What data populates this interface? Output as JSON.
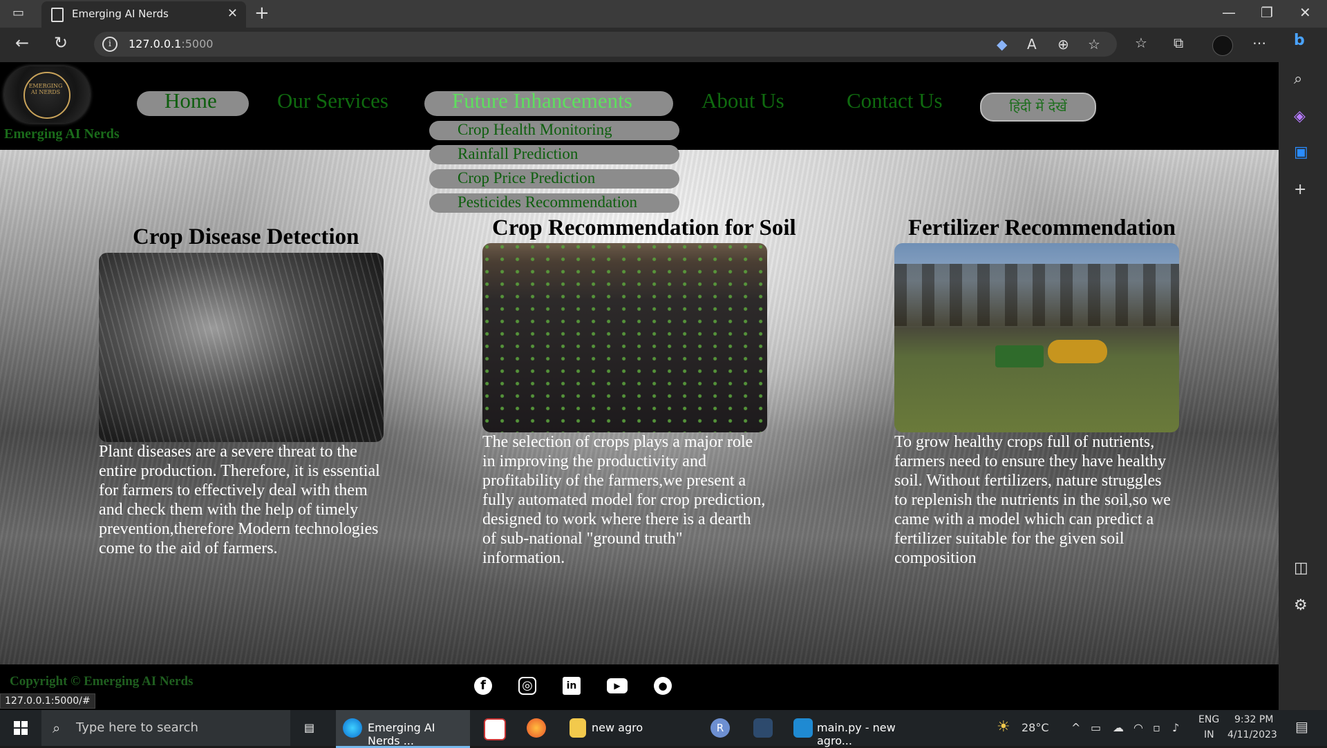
{
  "browser": {
    "tab_title": "Emerging AI Nerds",
    "url_host": "127.0.0.1",
    "url_port": ":5000",
    "status_url": "127.0.0.1:5000/#"
  },
  "site": {
    "brand": "Emerging AI Nerds",
    "logo_text": "EMERGING AI NERDS",
    "nav": {
      "home": "Home",
      "services": "Our Services",
      "future": "Future Inhancements",
      "about": "About Us",
      "contact": "Contact Us",
      "hindi": "हिंदी में देखें"
    },
    "dropdown": [
      "Crop Health Monitoring",
      "Rainfall Prediction",
      "Crop Price Prediction",
      "Pesticides Recommendation"
    ],
    "cards": [
      {
        "title": "Crop Disease Detection",
        "text": "Plant diseases are a severe threat to the entire production. Therefore, it is essential for farmers to effectively deal with them and check them with the help of timely prevention,therefore Modern technologies come to the aid of farmers."
      },
      {
        "title": "Crop Recommendation for Soil",
        "text": "The selection of crops plays a major role in improving the productivity and profitability of the farmers,we present a fully automated model for crop prediction, designed to work where there is a dearth of sub-national \"ground truth\" information."
      },
      {
        "title": "Fertilizer Recommendation",
        "text": "To grow healthy crops full of nutrients, farmers need to ensure they have healthy soil. Without fertilizers, nature struggles to replenish the nutrients in the soil,so we came with a model which can predict a fertilizer suitable for the given soil composition"
      }
    ],
    "footer": {
      "copyright": "Copyright © Emerging AI Nerds",
      "social_icons": [
        "facebook-icon",
        "instagram-icon",
        "linkedin-icon",
        "youtube-icon",
        "github-icon"
      ]
    }
  },
  "taskbar": {
    "search_placeholder": "Type here to search",
    "apps": {
      "edge": "Emerging AI Nerds ...",
      "folder": "new agro",
      "vscode": "main.py - new agro..."
    },
    "weather": "28°C",
    "lang": "ENG",
    "region": "IN",
    "time": "9:32 PM",
    "date": "4/11/2023"
  }
}
